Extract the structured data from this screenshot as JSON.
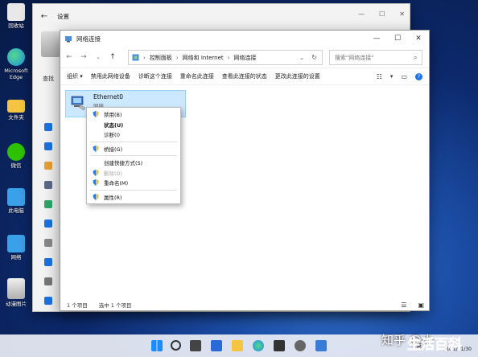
{
  "desktop": {
    "icons": [
      {
        "label": "回收站",
        "color": "#e8e8e8"
      },
      {
        "label": "Microsoft Edge",
        "color": "#2aa7e8"
      },
      {
        "label": "文件夹",
        "color": "#f5c542"
      },
      {
        "label": "微信",
        "color": "#2dc100"
      },
      {
        "label": "此电脑",
        "color": "#3aa0e8"
      },
      {
        "label": "网络",
        "color": "#3aa0e8"
      },
      {
        "label": "动漫图片",
        "color": "#d0d0d0"
      }
    ]
  },
  "settings": {
    "title": "设置",
    "search_stub": "查找"
  },
  "network_window": {
    "title": "网络连接",
    "breadcrumb": [
      "控制面板",
      "网络和 Internet",
      "网络连接"
    ],
    "search_placeholder": "搜索\"网络连接\"",
    "commands": [
      "组织 ▾",
      "禁用此网络设备",
      "诊断这个连接",
      "重命名此连接",
      "查看此连接的状态",
      "更改此连接的设置"
    ],
    "adapter": {
      "name": "Ethernet0",
      "sub": "网络"
    },
    "status": {
      "count": "1 个项目",
      "selected": "选中 1 个项目"
    }
  },
  "context_menu": {
    "items": [
      {
        "label": "禁用(B)",
        "icon": "shield-icon",
        "bold": false,
        "disabled": false
      },
      {
        "label": "状态(U)",
        "icon": "",
        "bold": true,
        "disabled": false
      },
      {
        "label": "诊断(I)",
        "icon": "",
        "bold": false,
        "disabled": false
      },
      {
        "label": "桥接(G)",
        "icon": "shield-icon",
        "bold": false,
        "disabled": false
      },
      {
        "label": "创建快捷方式(S)",
        "icon": "",
        "bold": false,
        "disabled": false
      },
      {
        "label": "删除(D)",
        "icon": "shield-icon",
        "bold": false,
        "disabled": true
      },
      {
        "label": "重命名(M)",
        "icon": "shield-icon",
        "bold": false,
        "disabled": false
      },
      {
        "label": "属性(R)",
        "icon": "shield-icon",
        "bold": false,
        "disabled": false
      }
    ]
  },
  "taskbar": {
    "ime": "英",
    "date": "2021/11/30"
  },
  "watermark": {
    "text": "知乎 @小",
    "brand": "生活百科"
  }
}
